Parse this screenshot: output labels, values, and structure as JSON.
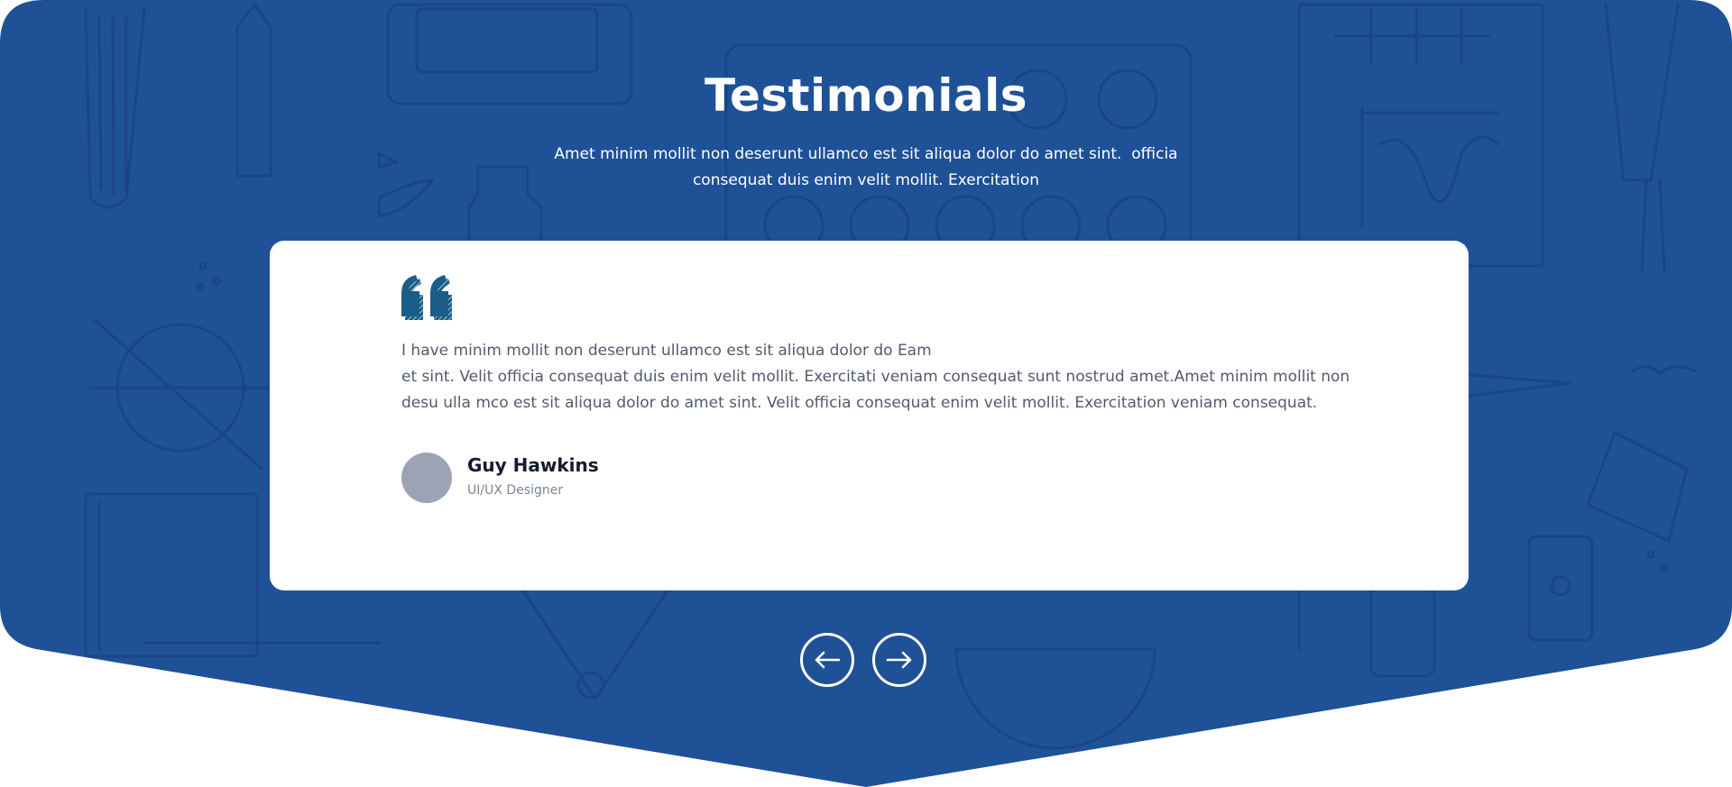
{
  "colors": {
    "primary_blue": "#1f5196",
    "doodle_line": "#1a4585",
    "card_bg": "#ffffff",
    "quote_icon": "#1a5e87",
    "avatar_placeholder": "#9ca3b4"
  },
  "section": {
    "title": "Testimonials",
    "subtitle_line1": "Amet minim mollit non deserunt ullamco est sit aliqua dolor do amet sint.  officia",
    "subtitle_line2": "consequat duis enim velit mollit. Exercitation"
  },
  "testimonial": {
    "quote_icon": "double-quote-icon",
    "text_line1": "I have minim mollit non deserunt ullamco est sit aliqua dolor do Eam",
    "text_line2": "et sint. Velit officia consequat duis enim velit mollit. Exercitati veniam consequat sunt nostrud amet.Amet minim mollit non",
    "text_line3": "desu ulla mco est sit aliqua dolor do amet sint. Velit officia consequat enim velit mollit. Exercitation veniam consequat.",
    "author_name": "Guy Hawkins",
    "author_role": "UI/UX Designer"
  },
  "navigation": {
    "prev_icon": "arrow-left-icon",
    "next_icon": "arrow-right-icon"
  }
}
